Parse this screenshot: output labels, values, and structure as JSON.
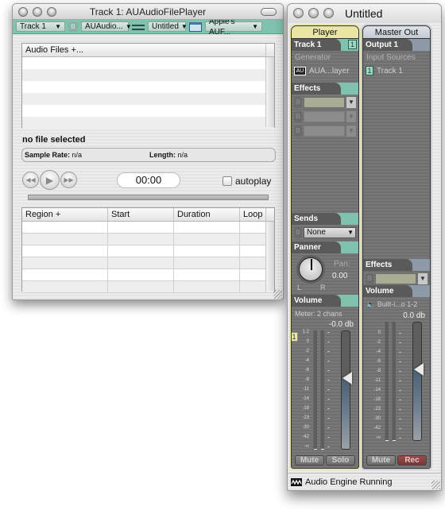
{
  "file_window": {
    "title": "Track 1: AUAudioFilePlayer",
    "toolbar": {
      "track_popup": "Track 1",
      "unit_popup": "AUAudio...",
      "preset_popup": "Untitled",
      "ui_popup": "Apple's AUF..."
    },
    "files_list": {
      "header": "Audio Files +...",
      "rows": 6
    },
    "status": "no file selected",
    "info": {
      "sample_rate_label": "Sample Rate:",
      "sample_rate_value": "n/a",
      "length_label": "Length:",
      "length_value": "n/a"
    },
    "transport": {
      "rewind": "rewind",
      "play": "play",
      "fast_forward": "fast-forward",
      "time": "00:00",
      "autoplay_label": "autoplay",
      "autoplay_checked": false,
      "progress": 0
    },
    "regions": {
      "columns": [
        "Region +",
        "Start",
        "Duration",
        "Loop"
      ],
      "rows": 6
    }
  },
  "mixer_window": {
    "title": "Untitled",
    "player_strip": {
      "header": "Player",
      "track_tab": "Track 1",
      "track_badge": "1",
      "generator_label": "Generator",
      "au_icon_text": "AU",
      "generator_name": "AUA...layer",
      "effects_tab": "Effects",
      "effects_bypass": "B",
      "sends_tab": "Sends",
      "sends_value": "None",
      "panner_tab": "Panner",
      "pan_label": "Pan:",
      "pan_value": "0.00",
      "pan_left": "L",
      "pan_right": "R",
      "volume_tab": "Volume",
      "meter_info": "Meter: 2 chans",
      "volume_db": "-0.0 db",
      "channel_badge": "1",
      "scale": [
        "1.2",
        "0",
        "-2",
        "-4",
        "-6",
        "-8",
        "-11",
        "-14",
        "-18",
        "-23",
        "-30",
        "-42",
        "-∞"
      ],
      "fader_level": 0.6,
      "mute_label": "Mute",
      "solo_label": "Solo"
    },
    "master_strip": {
      "header": "Master Out",
      "output_tab": "Output 1",
      "input_sources_label": "Input Sources",
      "source_badge": "1",
      "source_name": "Track 1",
      "effects_tab": "Effects",
      "volume_tab": "Volume",
      "output_device": "🔈 Built-i...o 1-2",
      "volume_db": "0.0 db",
      "scale": [
        "0",
        "-2",
        "-4",
        "-6",
        "-8",
        "-11",
        "-14",
        "-18",
        "-23",
        "-30",
        "-42",
        "-∞"
      ],
      "fader_level": 0.6,
      "mute_label": "Mute",
      "rec_label": "Rec"
    },
    "status": "Audio Engine Running"
  }
}
